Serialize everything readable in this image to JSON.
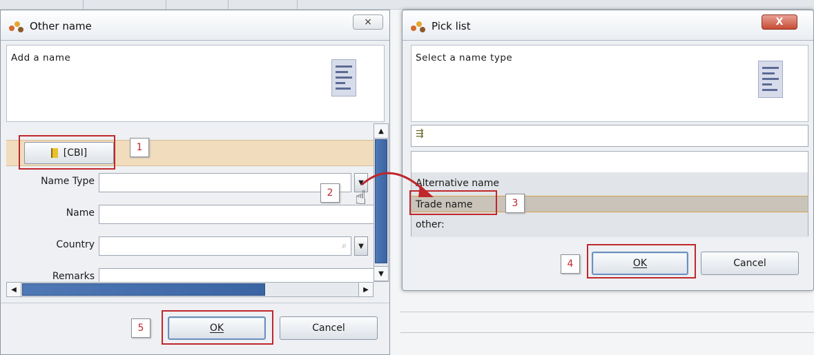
{
  "left_dialog": {
    "title": "Other name",
    "close_glyph": "⨯",
    "header_text": "Add a name",
    "cbi_button_label": "[CBI]",
    "fields": {
      "name_type_label": "Name Type",
      "name_type_value": "",
      "name_label": "Name",
      "name_value": "",
      "country_label": "Country",
      "country_value": "",
      "remarks_label": "Remarks"
    },
    "ok_label": "OK",
    "cancel_label": "Cancel"
  },
  "right_dialog": {
    "title": "Pick list",
    "close_glyph": "X",
    "header_text": "Select a name type",
    "filter_value": "",
    "options": [
      "Alternative name",
      "Trade name",
      "other:"
    ],
    "selected_option": "Trade name",
    "ok_label": "OK",
    "cancel_label": "Cancel"
  },
  "callouts": [
    "1",
    "2",
    "3",
    "4",
    "5"
  ],
  "colors": {
    "annotation_red": "#c0262b",
    "highlight_row": "#c9c3b9",
    "tab_tan": "#f1dcbd",
    "scroll_blue": "#3b64a3"
  },
  "icons": [
    "app-icon",
    "form-list-icon",
    "flag-icon",
    "magnifier-icon",
    "dropdown-arrow-icon",
    "hand-cursor-icon",
    "filter-icon"
  ]
}
